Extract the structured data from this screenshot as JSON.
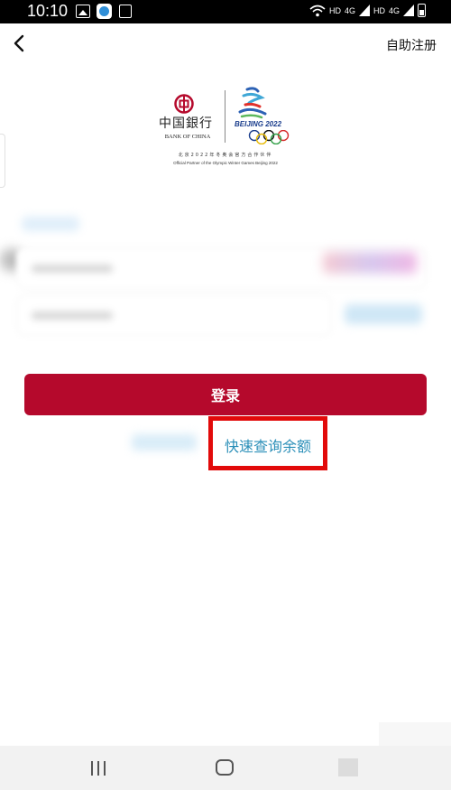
{
  "status_bar": {
    "time": "10:10",
    "network_labels": [
      "HD",
      "4G",
      "HD",
      "4G"
    ],
    "icons": [
      "gallery-icon",
      "app-icon",
      "edit-icon",
      "wifi-icon",
      "signal-icon",
      "battery-icon"
    ]
  },
  "header": {
    "back_icon": "chevron-left-icon",
    "register_label": "自助注册"
  },
  "logo": {
    "bank_name_cn": "中国銀行",
    "bank_name_en": "BANK OF CHINA",
    "olympic_text": "BEIJING 2022",
    "partner_cn": "北京2022年冬奥会官方合作伙伴",
    "partner_en": "Official Partner of the Olympic Winter Games Beijing 2022"
  },
  "login": {
    "login_label": "登录",
    "quick_balance_label": "快速查询余额"
  },
  "colors": {
    "brand": "#b5092c",
    "link": "#2b8fb8",
    "highlight": "#e20a0a"
  },
  "nav_bar": {
    "icons": [
      "recent-apps-icon",
      "home-icon",
      "back-icon"
    ]
  }
}
